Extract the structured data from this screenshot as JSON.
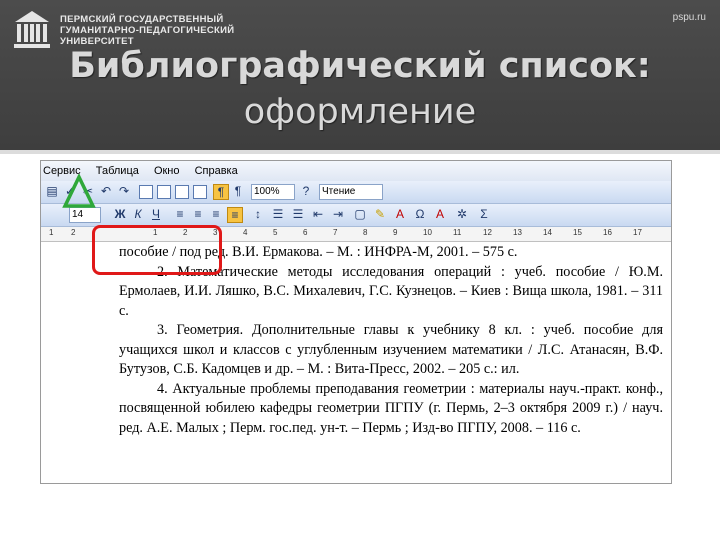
{
  "header": {
    "university": [
      "ПЕРМСКИЙ ГОСУДАРСТВЕННЫЙ",
      "ГУМАНИТАРНО-ПЕДАГОГИЧЕСКИЙ",
      "УНИВЕРСИТЕТ"
    ],
    "site": "pspu.ru",
    "title_line1": "Библиографический список:",
    "title_line2": "оформление"
  },
  "word": {
    "menu": [
      "Сервис",
      "Таблица",
      "Окно",
      "Справка"
    ],
    "zoom": "100%",
    "read_button": "Чтение",
    "font_size": "14",
    "ruler_marks": [
      "1",
      "2",
      "1",
      "2",
      "3",
      "4",
      "5",
      "6",
      "7",
      "8",
      "9",
      "10",
      "11",
      "12",
      "13",
      "14",
      "15",
      "16",
      "17"
    ]
  },
  "document": {
    "paragraphs": [
      "пособие / под ред. В.И. Ермакова. – М. : ИНФРА-М, 2001. – 575 с.",
      "2. Математические методы исследования операций : учеб. пособие / Ю.М. Ермолаев, И.И. Ляшко, В.С. Михалевич, Г.С. Кузнецов. – Киев : Вища школа, 1981. – 311 с.",
      "3. Геометрия. Дополнительные главы к учебнику 8 кл. : учеб. пособие для учащихся школ и классов с углубленным изучением математики / Л.С. Атанасян, В.Ф. Бутузов, С.Б. Кадомцев и др. – М. : Вита-Пресс, 2002. – 205 с.: ил.",
      "4. Актуальные проблемы преподавания геометрии : материалы науч.-практ. конф., посвященной юбилею кафедры геометрии ПГПУ (г. Пермь, 2–3 октября 2009 г.) / науч. ред. А.Е. Малых ; Перм. гос.пед. ун-т. – Пермь ; Изд-во ПГПУ, 2008. – 116 с."
    ]
  },
  "colors": {
    "header_bg": "#434343",
    "highlight": "#e01818",
    "marker": "#2fa83a"
  }
}
